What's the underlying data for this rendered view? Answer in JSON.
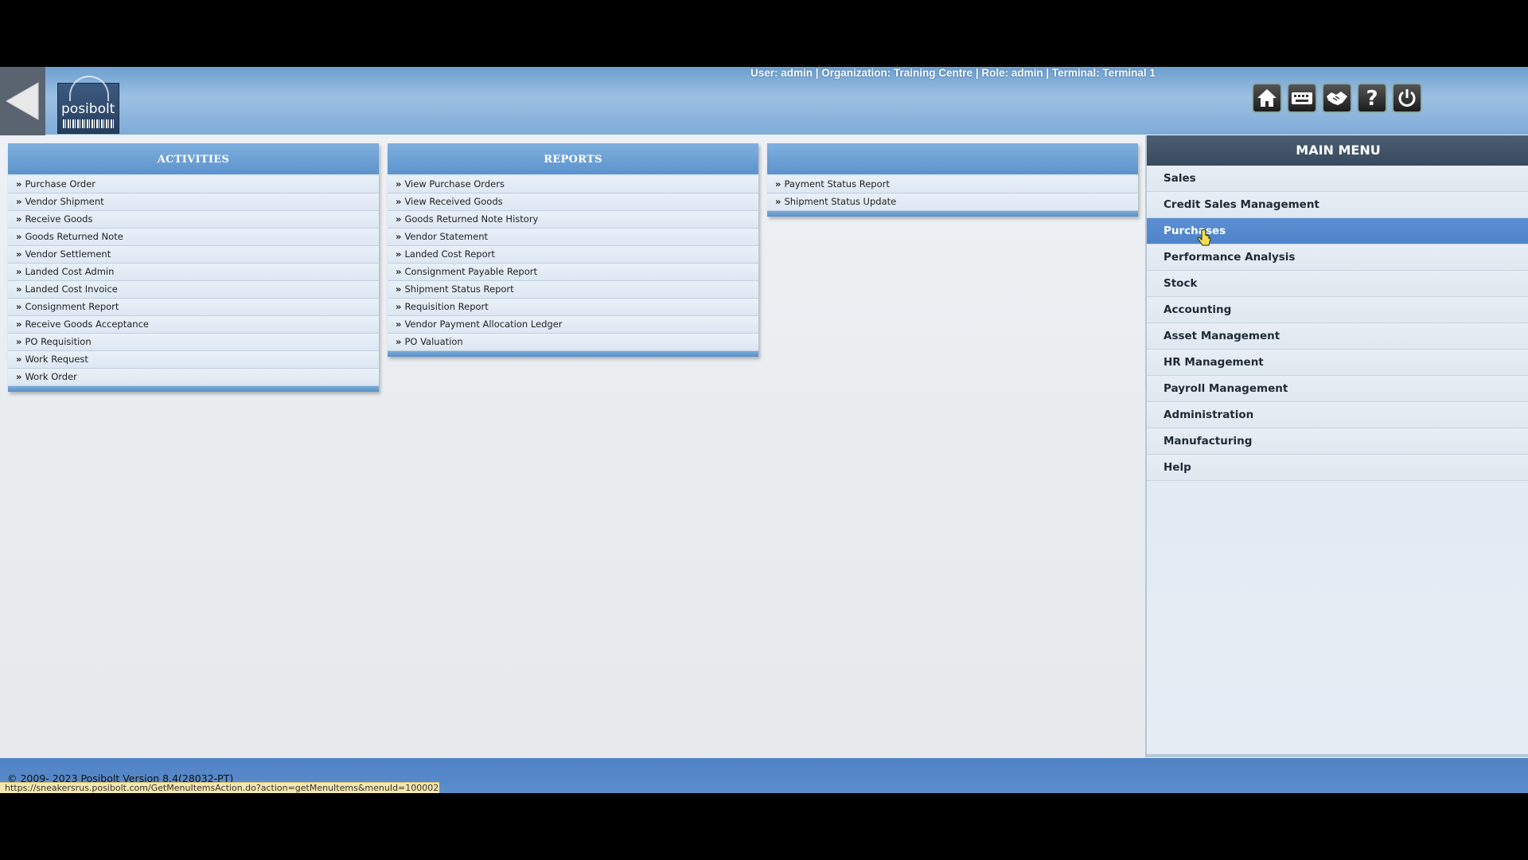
{
  "header": {
    "user_info": "User: admin | Organization: Training Centre | Role: admin | Terminal: Terminal 1",
    "logo_text": "posibolt",
    "toolbar_icons": [
      "home-icon",
      "keyboard-icon",
      "handshake-icon",
      "help-icon",
      "power-icon"
    ]
  },
  "panels": {
    "activities": {
      "title": "ACTIVITIES",
      "items": [
        "Purchase Order",
        "Vendor Shipment",
        "Receive Goods",
        "Goods Returned Note",
        "Vendor Settlement",
        "Landed Cost Admin",
        "Landed Cost Invoice",
        "Consignment Report",
        "Receive Goods Acceptance",
        "PO Requisition",
        "Work Request",
        "Work Order"
      ]
    },
    "reports": {
      "title": "REPORTS",
      "items": [
        "View Purchase Orders",
        "View Received Goods",
        "Goods Returned Note History",
        "Vendor Statement",
        "Landed Cost Report",
        "Consignment Payable Report",
        "Shipment Status Report",
        "Requisition Report",
        "Vendor Payment Allocation Ledger",
        "PO Valuation"
      ]
    },
    "other": {
      "title": "",
      "items": [
        "Payment Status Report",
        "Shipment Status Update"
      ]
    }
  },
  "main_menu": {
    "title": "MAIN MENU",
    "active_index": 2,
    "items": [
      "Sales",
      "Credit Sales Management",
      "Purchases",
      "Performance Analysis",
      "Stock",
      "Accounting",
      "Asset Management",
      "HR Management",
      "Payroll Management",
      "Administration",
      "Manufacturing",
      "Help"
    ]
  },
  "footer": {
    "copyright": "© 2009- 2023 Posibolt Version  8.4(28032-PT)",
    "status_url": "https://sneakersrus.posibolt.com/GetMenuItemsAction.do?action=getMenuItems&menuId=1000021"
  },
  "colors": {
    "header_blue": "#7eabd8",
    "panel_header": "#5c93cd",
    "menu_active": "#5c8fd2",
    "menu_title": "#4b5e73"
  }
}
